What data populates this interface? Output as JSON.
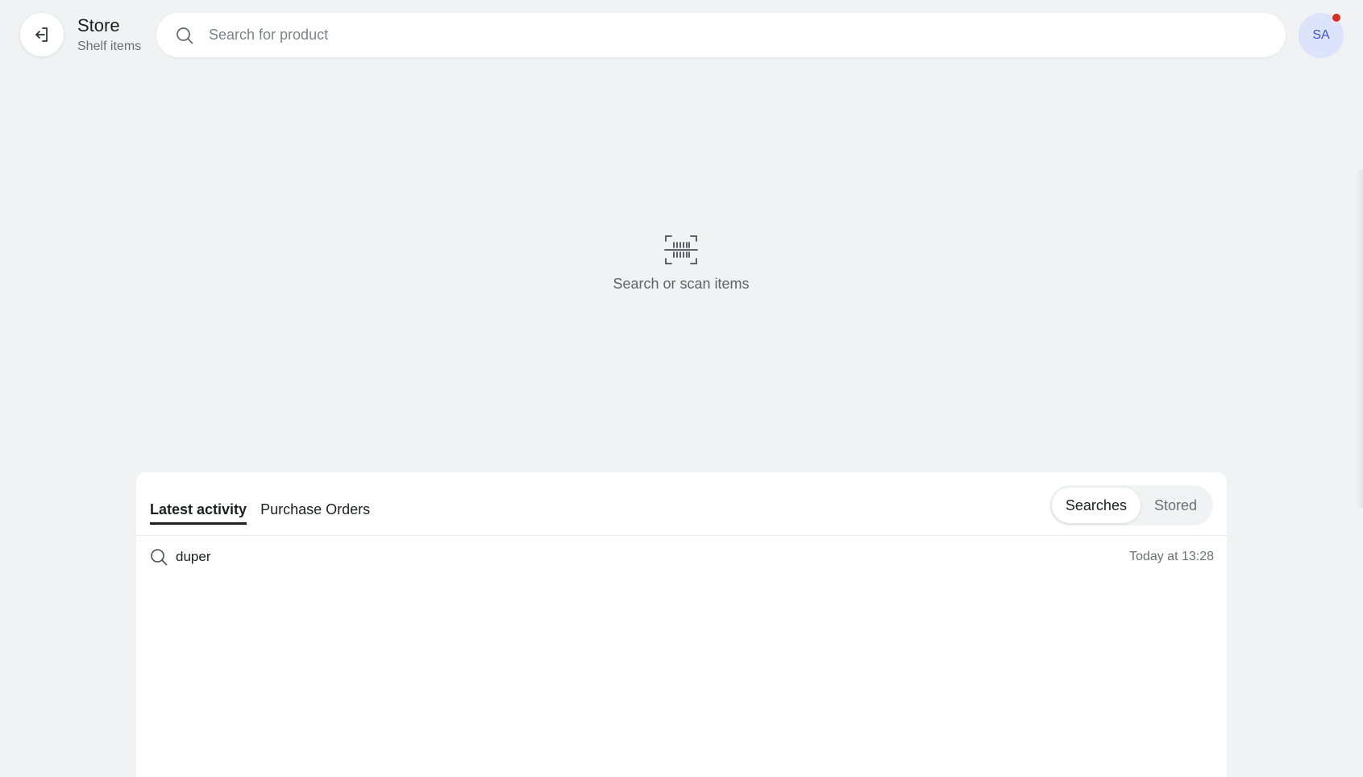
{
  "header": {
    "title": "Store",
    "subtitle": "Shelf items",
    "back_icon": "exit-arrow-icon"
  },
  "search": {
    "placeholder": "Search for product",
    "value": ""
  },
  "user": {
    "initials": "SA",
    "has_notification": true,
    "avatar_bg": "#dde3fb",
    "avatar_fg": "#3a56c8",
    "notification_color": "#d93025"
  },
  "empty_state": {
    "icon": "barcode-scan-icon",
    "text": "Search or scan items"
  },
  "activity_panel": {
    "tabs": [
      {
        "label": "Latest activity",
        "active": true
      },
      {
        "label": "Purchase Orders",
        "active": false
      }
    ],
    "segments": [
      {
        "label": "Searches",
        "active": true
      },
      {
        "label": "Stored",
        "active": false
      }
    ],
    "rows": [
      {
        "icon": "search-icon",
        "query": "duper",
        "time": "Today at 13:28"
      }
    ]
  }
}
